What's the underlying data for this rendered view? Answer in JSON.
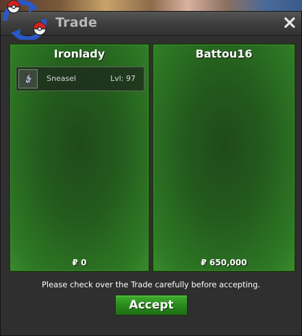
{
  "window": {
    "title": "Trade"
  },
  "left_panel": {
    "player_name": "Ironlady",
    "pokemon": [
      {
        "name": "Sneasel",
        "level": "Lvl: 97",
        "icon": "sneasel-sprite-icon"
      }
    ],
    "money": "₽ 0"
  },
  "right_panel": {
    "player_name": "Battou16",
    "pokemon": [],
    "money": "₽ 650,000"
  },
  "footer": {
    "notice": "Please check over the Trade carefully before accepting.",
    "accept_label": "Accept"
  },
  "colors": {
    "panel_green": "#2e7a25",
    "button_green": "#2a8a1d",
    "title_gray": "#b9b9b9"
  }
}
